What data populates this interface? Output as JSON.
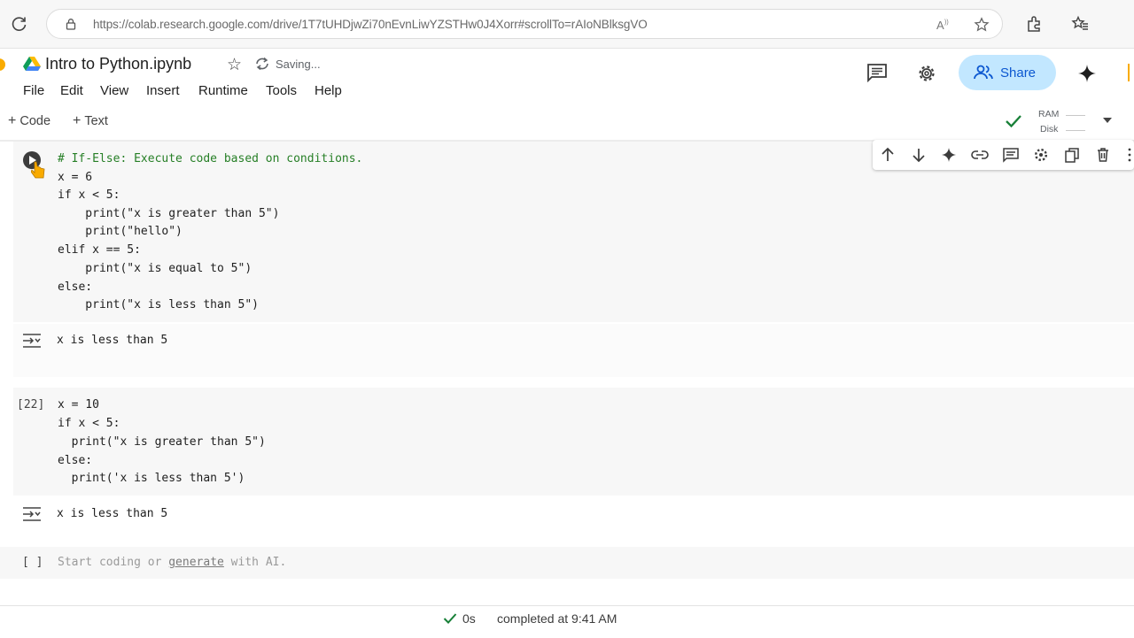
{
  "browser": {
    "url": "https://colab.research.google.com/drive/1T7tUHDjwZi70nEvnLiwYZSTHw0J4Xorr#scrollTo=rAIoNBlksgVO"
  },
  "notebook": {
    "title": "Intro to Python.ipynb",
    "save_status": "Saving..."
  },
  "menu": [
    "File",
    "Edit",
    "View",
    "Insert",
    "Runtime",
    "Tools",
    "Help"
  ],
  "header": {
    "share_label": "Share"
  },
  "toolbar": {
    "code_label": "Code",
    "text_label": "Text",
    "ram_label": "RAM",
    "disk_label": "Disk"
  },
  "cells": [
    {
      "exec_count": "",
      "code": [
        "# If-Else: Execute code based on conditions.",
        "x = 6",
        "if x < 5:",
        "    print(\"x is greater than 5\")",
        "    print(\"hello\")",
        "elif x == 5:",
        "    print(\"x is equal to 5\")",
        "else:",
        "    print(\"x is less than 5\")"
      ],
      "output": "x is less than 5"
    },
    {
      "exec_count": "[22]",
      "code": [
        "x = 10",
        "if x < 5:",
        "  print(\"x is greater than 5\")",
        "else:",
        "  print('x is less than 5')"
      ],
      "output": "x is less than 5"
    }
  ],
  "empty_cell": {
    "bracket": "[ ]",
    "placeholder_before": "Start coding or ",
    "placeholder_link": "generate",
    "placeholder_after": " with AI."
  },
  "status": {
    "exec_time": "0s",
    "message": "completed at 9:41 AM"
  },
  "colors": {
    "accent": "#0b57d0",
    "share_bg": "#c2e7ff",
    "keyword": "#8e24aa",
    "string": "#a31515",
    "number": "#0b8043",
    "comment": "#267f26"
  }
}
